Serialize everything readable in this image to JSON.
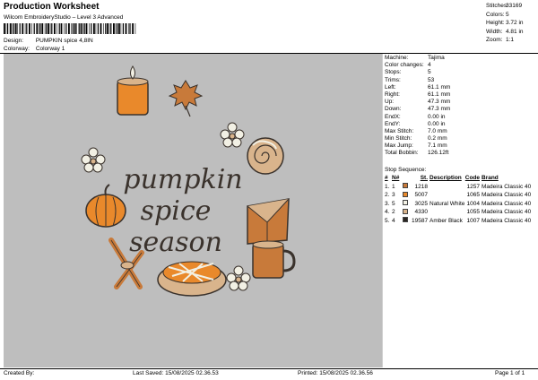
{
  "header": {
    "title": "Production Worksheet",
    "subtitle": "Wilcom EmbroideryStudio – Level 3 Advanced",
    "design_label": "Design:",
    "design_value": "PUMPKIN spice 4,8IN",
    "colorway_label": "Colorway:",
    "colorway_value": "Colorway 1"
  },
  "stats": [
    {
      "label": "Stitches:",
      "value": "33169"
    },
    {
      "label": "Colors:",
      "value": "5"
    },
    {
      "label": "Height:",
      "value": "3.72 in"
    },
    {
      "label": "Width:",
      "value": "4.81 in"
    },
    {
      "label": "Zoom:",
      "value": "1:1"
    }
  ],
  "properties": [
    {
      "label": "Machine:",
      "value": "Tajima"
    },
    {
      "label": "Color changes:",
      "value": "4"
    },
    {
      "label": "Stops:",
      "value": "5"
    },
    {
      "label": "Trims:",
      "value": "53"
    },
    {
      "label": "Left:",
      "value": "61.1 mm"
    },
    {
      "label": "Right:",
      "value": "61.1 mm"
    },
    {
      "label": "Up:",
      "value": "47.3 mm"
    },
    {
      "label": "Down:",
      "value": "47.3 mm"
    },
    {
      "label": "EndX:",
      "value": "0.00 in"
    },
    {
      "label": "EndY:",
      "value": "0.00 in"
    },
    {
      "label": "Max Stitch:",
      "value": "7.0 mm"
    },
    {
      "label": "Min Stitch:",
      "value": "0.2 mm"
    },
    {
      "label": "Max Jump:",
      "value": "7.1 mm"
    },
    {
      "label": "Total Bobbin:",
      "value": "126.12ft"
    }
  ],
  "stop_sequence": {
    "title": "Stop Sequence:",
    "headers": {
      "num": "#",
      "n": "N#",
      "st": "St.",
      "desc": "Description",
      "code": "Code",
      "brand": "Brand"
    },
    "rows": [
      {
        "num": "1.",
        "n": "1",
        "color": "#c87a3a",
        "st": "1218",
        "desc": "",
        "code": "1257",
        "brand": "Madeira Classic 40"
      },
      {
        "num": "2.",
        "n": "3",
        "color": "#e9892b",
        "st": "5007",
        "desc": "",
        "code": "1065",
        "brand": "Madeira Classic 40"
      },
      {
        "num": "3.",
        "n": "5",
        "color": "#f2f0e4",
        "st": "3025",
        "desc": "Natural White",
        "code": "1004",
        "brand": "Madeira Classic 40"
      },
      {
        "num": "4.",
        "n": "2",
        "color": "#d9b48c",
        "st": "4330",
        "desc": "",
        "code": "1055",
        "brand": "Madeira Classic 40"
      },
      {
        "num": "5.",
        "n": "4",
        "color": "#2b2622",
        "st": "19587",
        "desc": "Amber Black",
        "code": "1007",
        "brand": "Madeira Classic 40"
      }
    ]
  },
  "design": {
    "line1": "pumpkin",
    "line2": "spice",
    "line3": "season"
  },
  "footer": {
    "created_by": "Created By:",
    "last_saved": "Last Saved: 15/08/2025 02.36.53",
    "printed": "Printed: 15/08/2025 02.36.56",
    "page": "Page 1 of 1"
  },
  "colors": {
    "canvas_bg": "#bebebe",
    "outline": "#3a322c",
    "orange": "#e9892b",
    "rust": "#c87a3a",
    "tan": "#d9b48c",
    "cream": "#f2f0e4"
  }
}
